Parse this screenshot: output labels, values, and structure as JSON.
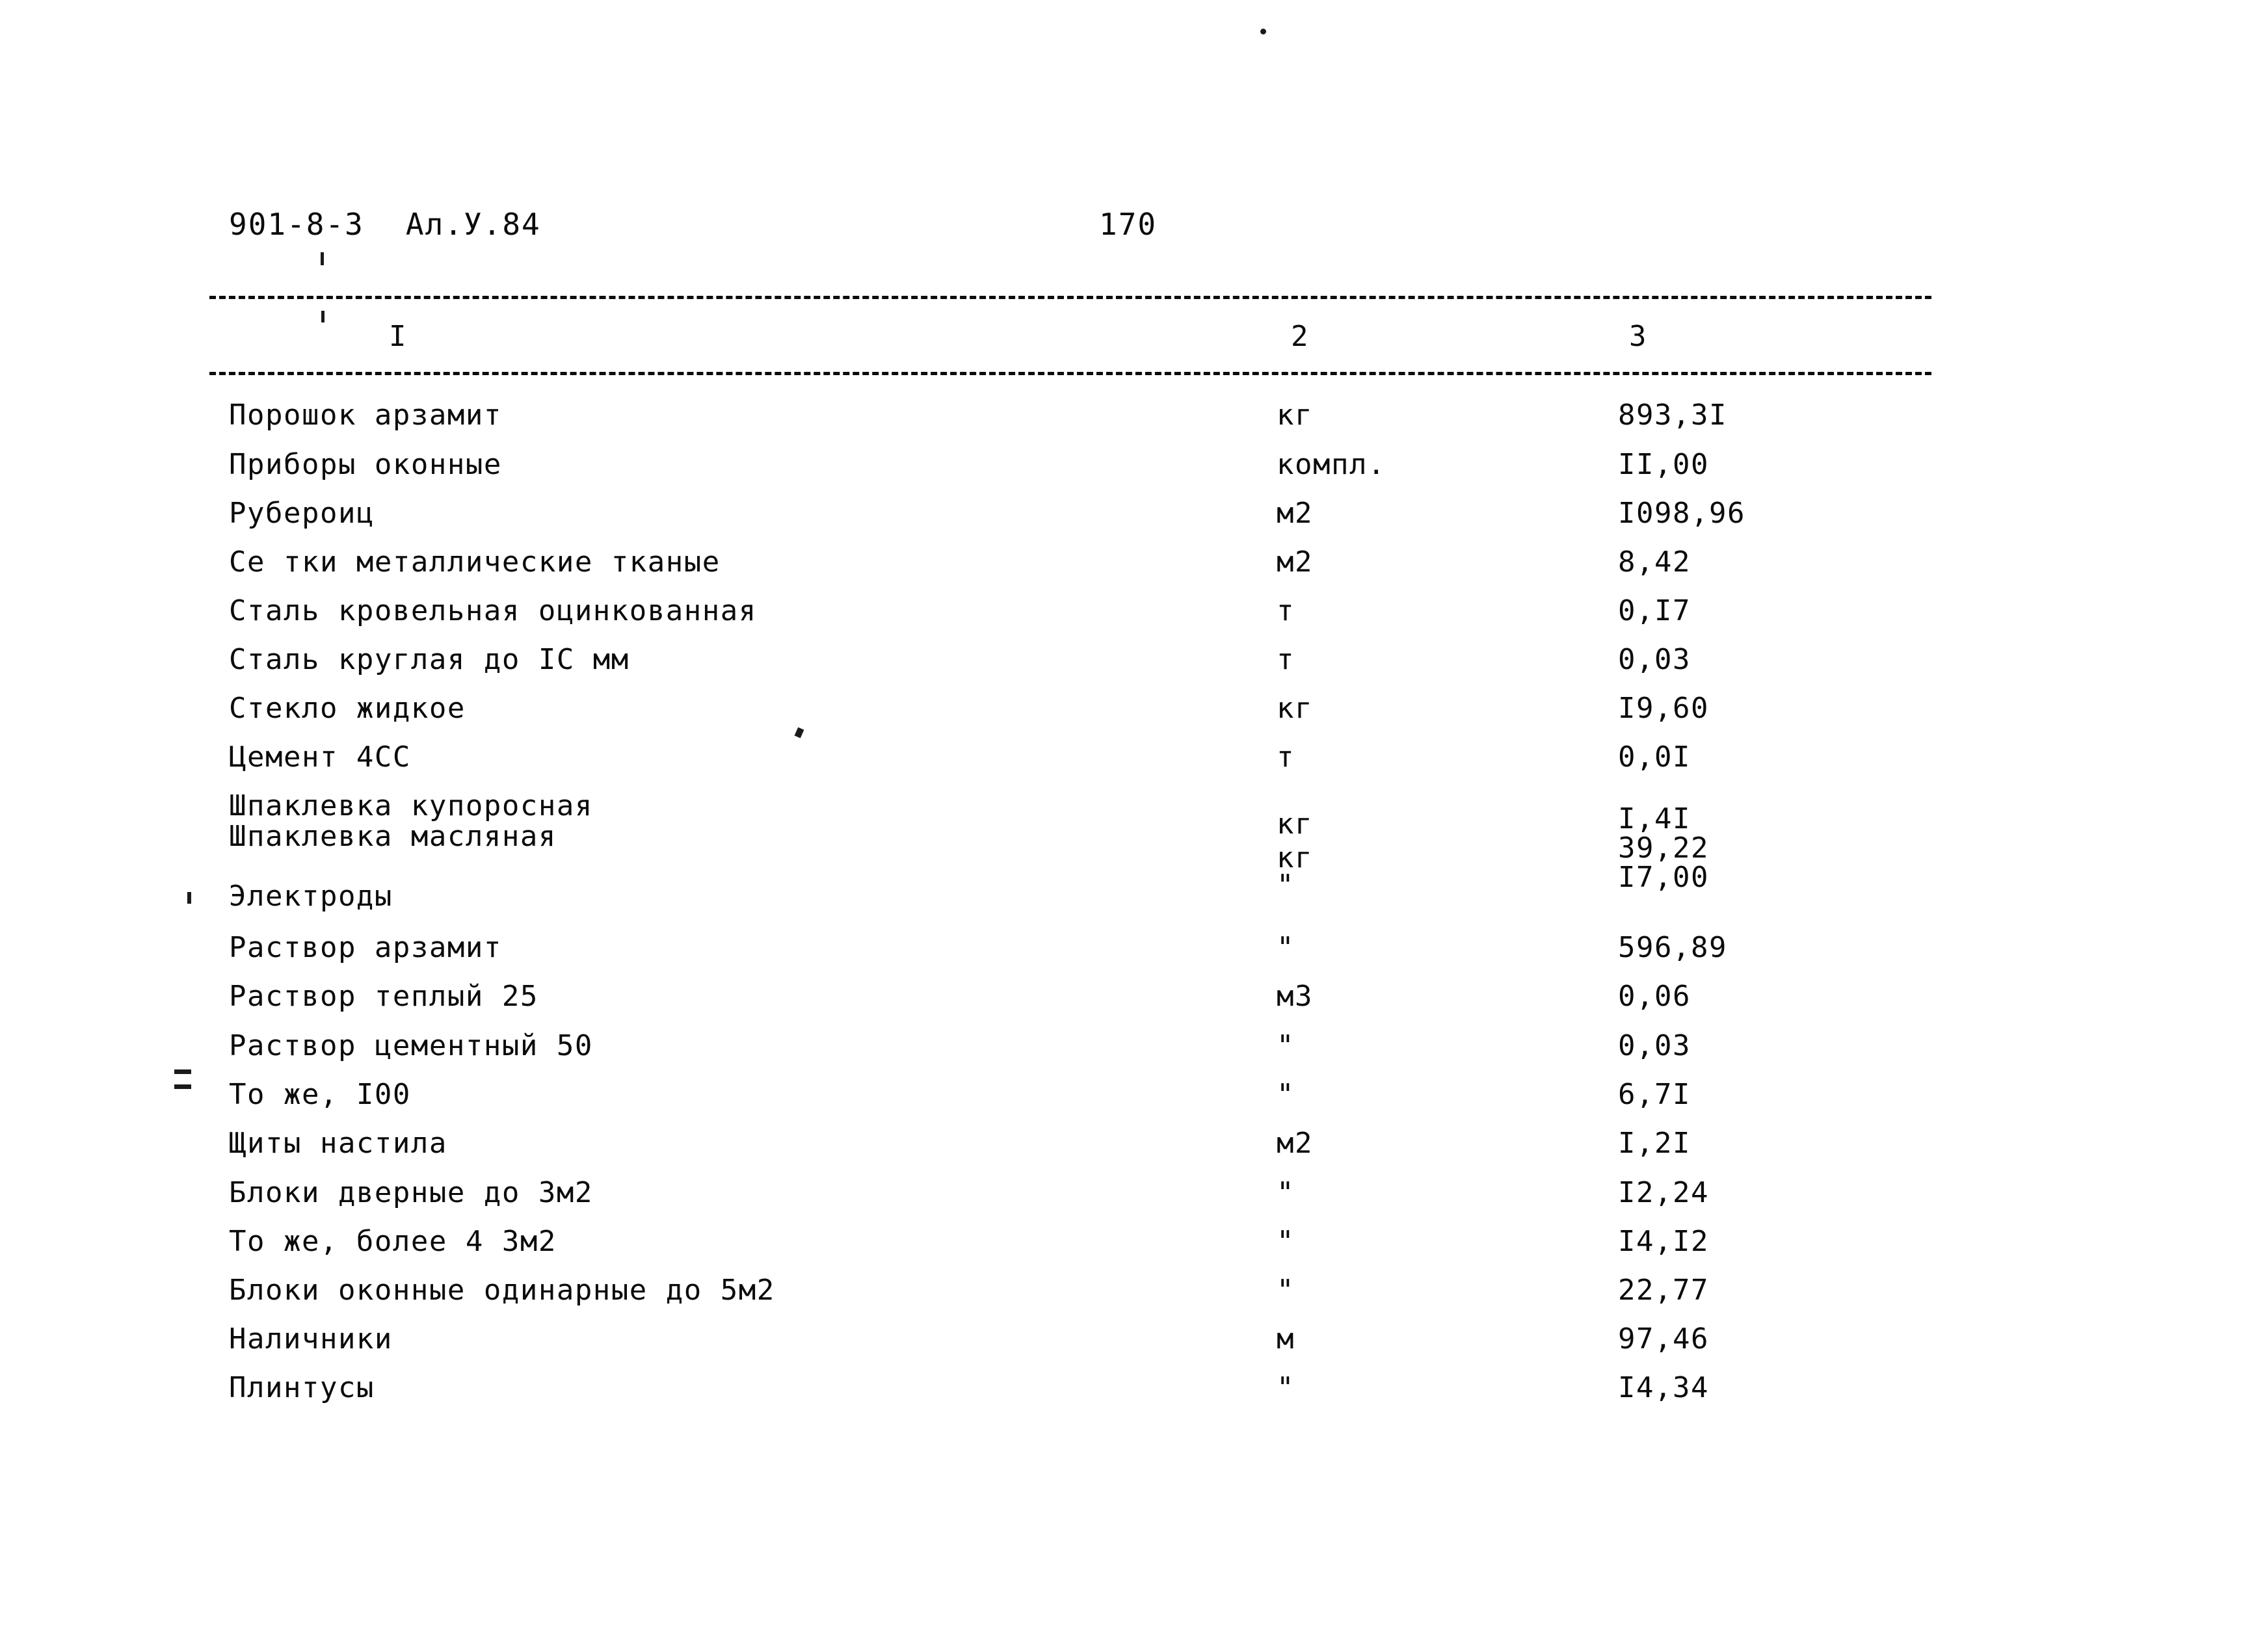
{
  "document": {
    "header_code": "901-8-3",
    "header_album": "Ал.У.84",
    "page_number": "170"
  },
  "table": {
    "column_numbers": [
      "I",
      "2",
      "3"
    ],
    "rows": [
      {
        "name": "Порошок арзамит",
        "unit": "кг",
        "value": "893,3I"
      },
      {
        "name": "Приборы оконные",
        "unit": "компл.",
        "value": "II,00"
      },
      {
        "name": "Рубероиц",
        "unit": "м2",
        "value": "I098,96"
      },
      {
        "name": "Се тки металлические тканые",
        "unit": "м2",
        "value": "8,42"
      },
      {
        "name": "Сталь кровельная оцинкованная",
        "unit": "т",
        "value": "0,I7"
      },
      {
        "name": "Сталь круглая до IC мм",
        "unit": "т",
        "value": "0,03"
      },
      {
        "name": "Стекло жидкое",
        "unit": "кг",
        "value": "I9,60"
      },
      {
        "name": "Цемент 4CC",
        "unit": "т",
        "value": "0,0I"
      },
      {
        "name": "Шпаклевка купоросная",
        "unit": "",
        "value": ""
      },
      {
        "name": "Шпаклевка масляная",
        "unit": "кг",
        "value": "I,4I"
      },
      {
        "name": "",
        "unit": "кг",
        "value": "39,22"
      },
      {
        "name": "Электроды",
        "unit": "\"",
        "value": "I7,00"
      },
      {
        "name": "Раствор арзамит",
        "unit": "\"",
        "value": "596,89"
      },
      {
        "name": "Раствор теплый 25",
        "unit": "м3",
        "value": "0,06"
      },
      {
        "name": "Раствор цементный 50",
        "unit": "\"",
        "value": "0,03"
      },
      {
        "name": "То же, I00",
        "unit": "\"",
        "value": "6,7I"
      },
      {
        "name": "Щиты настила",
        "unit": "м2",
        "value": "I,2I"
      },
      {
        "name": "Блоки дверные до 3м2",
        "unit": "\"",
        "value": "I2,24"
      },
      {
        "name": "То же, более 4 3м2",
        "unit": "\"",
        "value": "I4,I2"
      },
      {
        "name": "Блоки оконные одинарные до 5м2",
        "unit": "\"",
        "value": "22,77"
      },
      {
        "name": "Наличники",
        "unit": "м",
        "value": "97,46"
      },
      {
        "name": "Плинтусы",
        "unit": "\"",
        "value": "I4,34"
      }
    ]
  },
  "layout": {
    "name_tops": [
      617,
      693,
      768,
      843,
      918,
      993,
      1068,
      1143,
      1218,
      1265,
      0,
      1357,
      1436,
      1511,
      1587,
      1662,
      1737,
      1813,
      1888,
      1963,
      2038,
      2113
    ],
    "unit_tops": [
      617,
      693,
      768,
      843,
      918,
      993,
      1068,
      1143,
      0,
      1246,
      1298,
      1340,
      1436,
      1511,
      1587,
      1662,
      1737,
      1813,
      1888,
      1963,
      2038,
      2113
    ],
    "value_tops": [
      617,
      693,
      768,
      843,
      918,
      993,
      1068,
      1143,
      0,
      1238,
      1283,
      1328,
      1436,
      1511,
      1587,
      1662,
      1737,
      1813,
      1888,
      1963,
      2038,
      2113
    ]
  }
}
